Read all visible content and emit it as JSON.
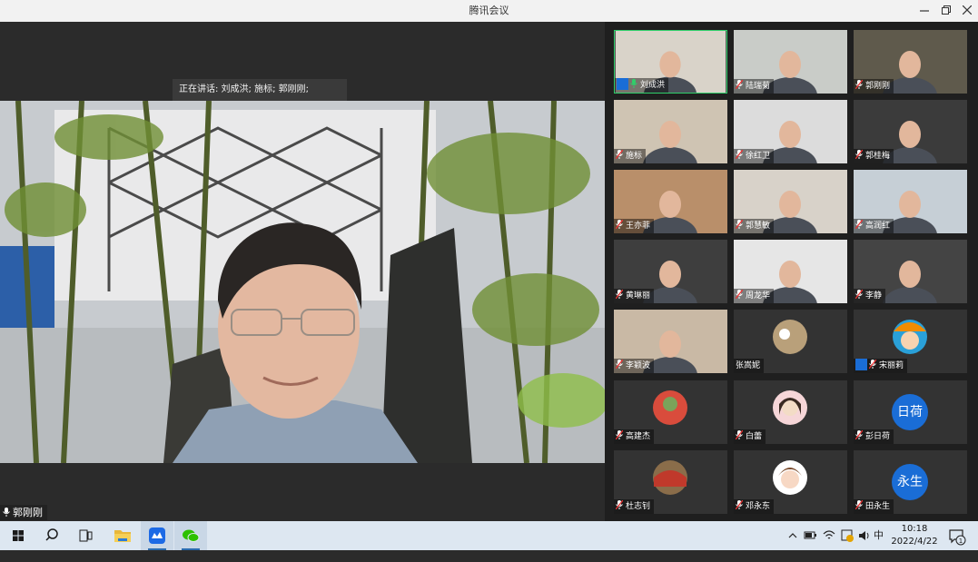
{
  "window": {
    "title": "腾讯会议"
  },
  "main": {
    "speaking_label": "正在讲话: 刘成洪; 施标; 郭刚刚;",
    "self_name": "郭刚刚"
  },
  "participants": [
    {
      "name": "刘成洪",
      "type": "video"
    },
    {
      "name": "陆瑞菊",
      "type": "video"
    },
    {
      "name": "郭刚刚",
      "type": "video"
    },
    {
      "name": "施标",
      "type": "video"
    },
    {
      "name": "徐红卫",
      "type": "video"
    },
    {
      "name": "郭桂梅",
      "type": "video"
    },
    {
      "name": "王亦菲",
      "type": "video"
    },
    {
      "name": "郭慧敏",
      "type": "video"
    },
    {
      "name": "高润红",
      "type": "video"
    },
    {
      "name": "黄琳丽",
      "type": "video"
    },
    {
      "name": "周龙华",
      "type": "video"
    },
    {
      "name": "李静",
      "type": "video"
    },
    {
      "name": "李颖波",
      "type": "video"
    },
    {
      "name": "张嵩妮",
      "type": "avatar"
    },
    {
      "name": "宋丽莉",
      "type": "avatar"
    },
    {
      "name": "高建杰",
      "type": "avatar"
    },
    {
      "name": "白蕾",
      "type": "avatar"
    },
    {
      "name": "彭日荷",
      "type": "text-avatar",
      "avatar_text": "日荷"
    },
    {
      "name": "杜志钊",
      "type": "avatar"
    },
    {
      "name": "邓永东",
      "type": "avatar"
    },
    {
      "name": "田永生",
      "type": "text-avatar",
      "avatar_text": "永生"
    }
  ],
  "taskbar": {
    "ime": "中",
    "time": "10:18",
    "date": "2022/4/22",
    "notification_count": "1"
  },
  "colors": {
    "accent": "#1a6dd6",
    "active_border": "#2fcf6a"
  }
}
